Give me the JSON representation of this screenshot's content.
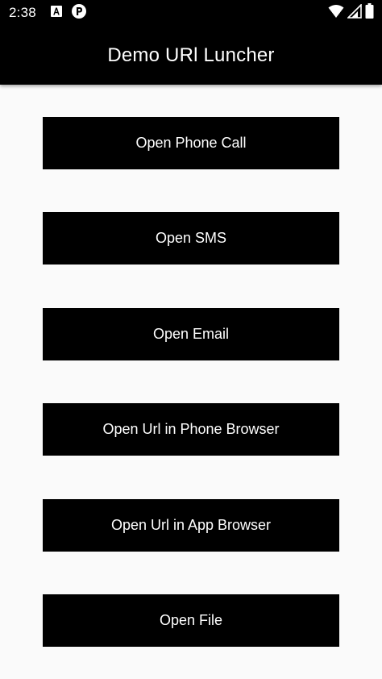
{
  "status_bar": {
    "time": "2:38",
    "icons": [
      "font-a-icon",
      "notification-p-icon",
      "wifi-icon",
      "signal-icon",
      "battery-icon"
    ]
  },
  "app_bar": {
    "title": "Demo URl Luncher"
  },
  "buttons": [
    {
      "label": "Open Phone Call"
    },
    {
      "label": "Open SMS"
    },
    {
      "label": "Open Email"
    },
    {
      "label": "Open Url in Phone Browser"
    },
    {
      "label": "Open Url in App Browser"
    },
    {
      "label": "Open File"
    }
  ],
  "colors": {
    "app_bar": "#000000",
    "button_bg": "#000000",
    "button_text": "#ffffff",
    "page_bg": "#fafafa"
  }
}
